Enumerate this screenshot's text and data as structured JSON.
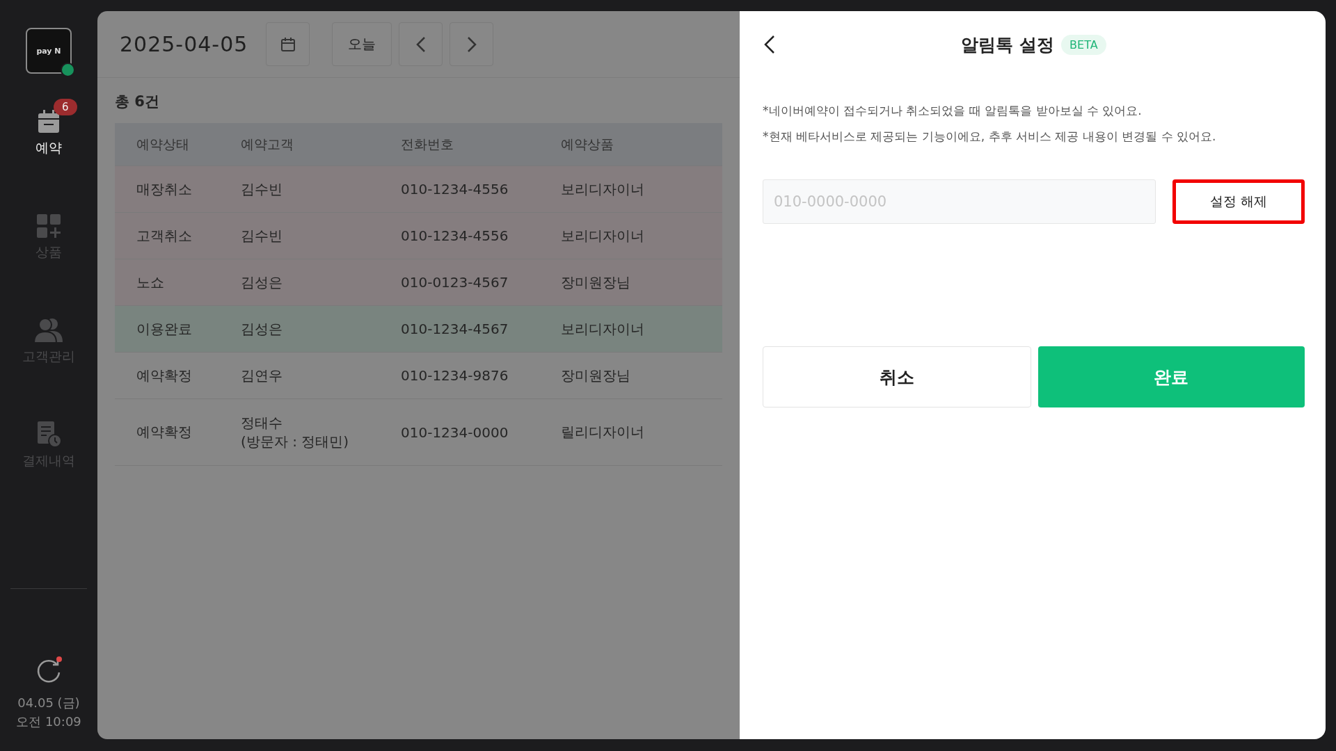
{
  "sidebar": {
    "logo": "pay N",
    "online": true,
    "items": [
      {
        "label": "예약",
        "kind": "calendar",
        "selected": true,
        "badge": "6"
      },
      {
        "label": "상품",
        "kind": "products",
        "selected": false
      },
      {
        "label": "고객관리",
        "kind": "customers",
        "selected": false
      },
      {
        "label": "결제내역",
        "kind": "payments",
        "selected": false
      }
    ],
    "sync_pending": true,
    "date": "04.05 (금)",
    "time": "오전 10:09"
  },
  "toolbar": {
    "date": "2025-04-05",
    "today_button": "오늘"
  },
  "total": "총 6건",
  "table": {
    "columns": [
      "예약상태",
      "예약고객",
      "전화번호",
      "예약상품"
    ],
    "rows": [
      {
        "color": "#857d7f",
        "cells": [
          "매장취소",
          "김수빈",
          "010-1234-4556",
          "보리디자이너"
        ]
      },
      {
        "color": "#857d7f",
        "cells": [
          "고객취소",
          "김수빈",
          "010-1234-4556",
          "보리디자이너"
        ]
      },
      {
        "color": "#857d7f",
        "cells": [
          "노쇼",
          "김성은",
          "010-0123-4567",
          "장미원장님"
        ]
      },
      {
        "color": "#79847f",
        "cells": [
          "이용완료",
          "김성은",
          "010-1234-4567",
          "보리디자이너"
        ]
      },
      {
        "color": "#878787",
        "cells": [
          "예약확정",
          "김연우",
          "010-1234-9876",
          "장미원장님"
        ]
      },
      {
        "color": "#878787",
        "cells": [
          "예약확정",
          "정태수\n(방문자 : 정태민)",
          "010-1234-0000",
          "릴리디자이너"
        ]
      }
    ]
  },
  "panel": {
    "title": "알림톡 설정",
    "badge": "BETA",
    "notes": [
      "*네이버예약이 접수되거나 취소되었을 때 알림톡을 받아보실 수 있어요.",
      "*현재 베타서비스로 제공되는 기능이에요, 추후 서비스 제공 내용이 변경될 수 있어요."
    ],
    "phone": {
      "placeholder": "010-0000-0000"
    },
    "unset_button": {
      "label": "설정 해제",
      "highlighted": true
    },
    "buttons": [
      {
        "label": "취소",
        "kind": "secondary"
      },
      {
        "label": "완료",
        "kind": "primary"
      }
    ]
  }
}
